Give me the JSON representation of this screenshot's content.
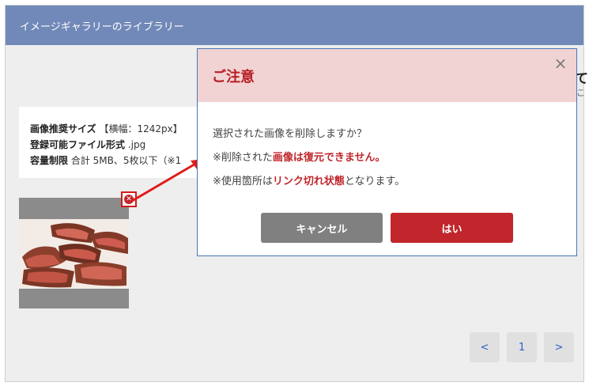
{
  "window": {
    "title": "イメージギャラリーのライブラリー"
  },
  "background": {
    "partial_heading": "て",
    "partial_sub": "こ",
    "info": {
      "recommended_label": "画像推奨サイズ",
      "recommended_value": "【横幅：1242px】",
      "formats_label": "登録可能ファイル形式",
      "formats_value": ".jpg",
      "limit_label": "容量制限",
      "limit_value": "合計 5MB、5枚以下（※1"
    },
    "thumbnail": {
      "alt": "grilled steak slices"
    },
    "pagination": {
      "prev": "<",
      "page": "1",
      "next": ">"
    }
  },
  "dialog": {
    "title": "ご注意",
    "close": "×",
    "line1": "選択された画像を削除しますか？",
    "line2_prefix": "※削除された",
    "line2_emph": "画像は復元できません。",
    "line3_prefix": "※使用箇所は",
    "line3_emph": "リンク切れ状態",
    "line3_suffix": "となります。",
    "cancel_label": "キャンセル",
    "ok_label": "はい"
  },
  "colors": {
    "titlebar": "#7189b8",
    "dialog_header": "#f2d3d4",
    "accent_red": "#c0262b",
    "cancel_gray": "#808080",
    "link_blue": "#2f5fc8"
  },
  "icons": {
    "delete": "close-circle-icon",
    "dialog_close": "close-icon"
  }
}
